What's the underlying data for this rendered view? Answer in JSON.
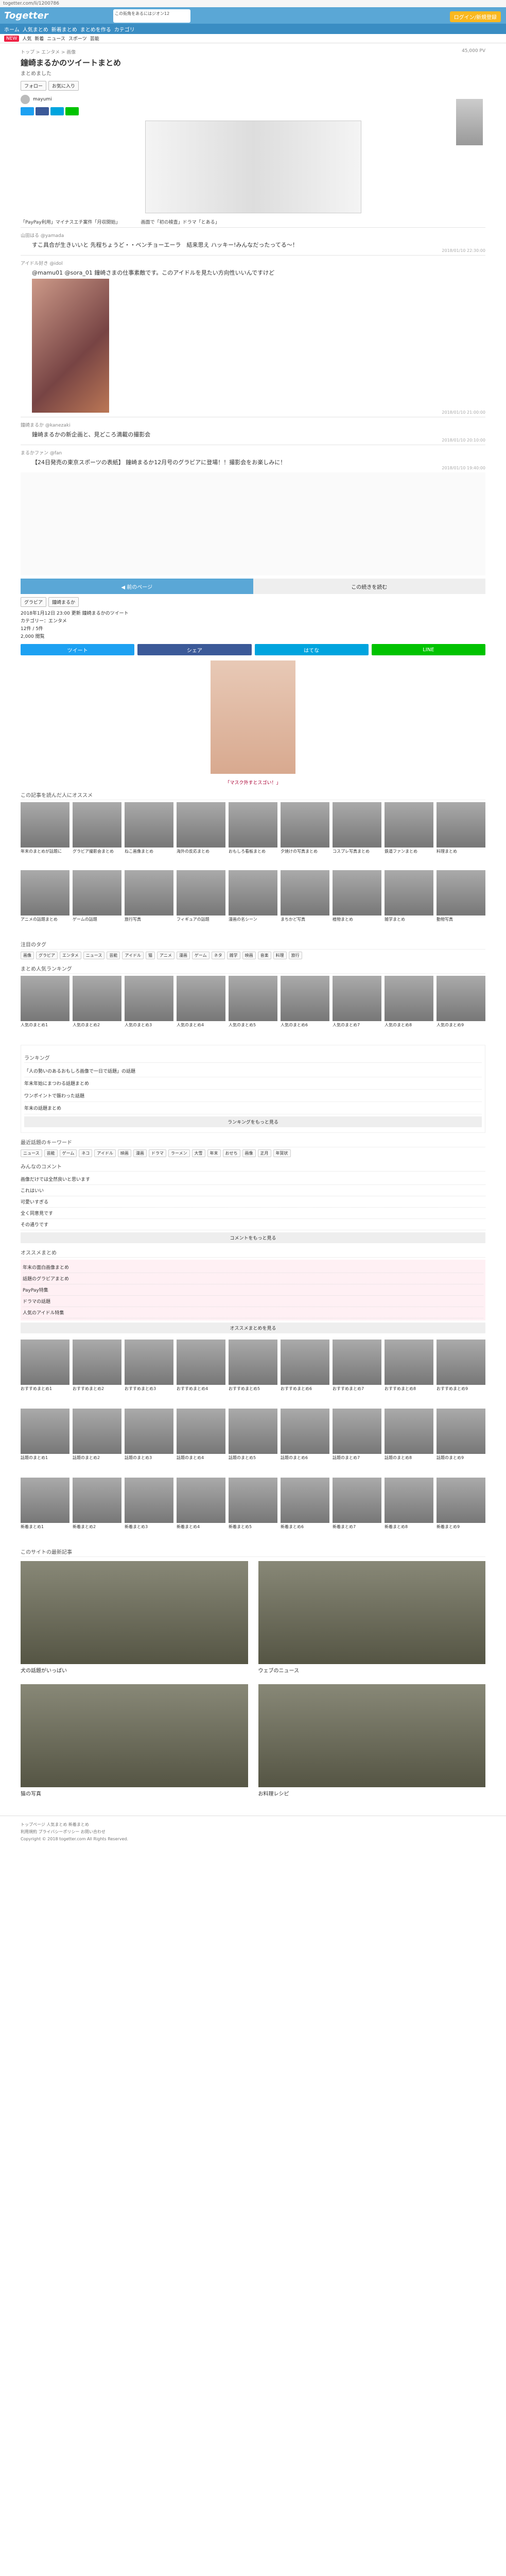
{
  "browser": {
    "url": "togetter.com/li/1200786"
  },
  "header": {
    "logo": "Togetter",
    "banner": "この街角をあるにはジオン12",
    "login": "ログイン/新規登録",
    "nav": [
      "ホーム",
      "人気まとめ",
      "新着まとめ",
      "まとめを作る",
      "カテゴリ"
    ],
    "subnav_new": "NEW",
    "subnav": [
      "人気",
      "新着",
      "ニュース",
      "スポーツ",
      "芸能"
    ]
  },
  "article": {
    "breadcrumb": "トップ > エンタメ > 画像",
    "stats": "45,000 PV",
    "title": "鐘崎まるかのツイートまとめ",
    "subtitle": "まとめました",
    "btn_follow": "フォロー",
    "btn_fav": "お気に入り",
    "user": "mayumi",
    "ads": [
      "「PayPay利用」マイナスエチ案件「月収開始」",
      "画面で「初の検査」ドラマ「とある」"
    ],
    "tweets": [
      {
        "name": "山田はる @yamada",
        "text": "すこ具合が生きいいと\n先程ちょうど・・ベンチョーエーラ　結来思え\nハッキー!みんなだったってる〜！",
        "date": "2018/01/10 22:30:00"
      },
      {
        "name": "アイドル好き @idol",
        "text": "@mamu01 @sora_01 鐘崎さまの仕事素敵です。このアイドルを見たい方向性いいんですけど",
        "date": "2018/01/10 21:00:00",
        "photo": true
      },
      {
        "name": "鐘崎まるか @kanezaki",
        "text": "鐘崎まるかの新企画と、見どころ満載の撮影会",
        "date": "2018/01/10 20:10:00"
      },
      {
        "name": "まるかファン @fan",
        "text": "【24日発売の東京スポーツの表紙】 鐘崎まるか12月号のグラビアに登場！！撮影会をお楽しみに！",
        "date": "2018/01/10 19:40:00"
      }
    ],
    "pager_prev": "◀ 前のページ",
    "pager_next": "この続きを読む",
    "tags": [
      "グラビア",
      "鐘崎まるか"
    ],
    "info": [
      "2018年1月12日 23:00 更新 鐘崎まるかのツイート",
      "カテゴリー：エンタメ",
      "12件 / 5件",
      "2,000 閲覧"
    ],
    "share": [
      "ツイート",
      "シェア",
      "はてな",
      "LINE"
    ],
    "adcaption": "「マスク外すとスゴい！」"
  },
  "sections": {
    "related": "この記事を読んだ人にオススメ",
    "related_cards": [
      "年末のまとめが話題に",
      "グラビア撮影会まとめ",
      "ねこ画像まとめ",
      "海外の反応まとめ",
      "おもしろ看板まとめ",
      "夕焼けの写真まとめ",
      "コスプレ写真まとめ",
      "鉄道ファンまとめ",
      "料理まとめ",
      "アニメの話題まとめ",
      "ゲームの話題",
      "旅行写真",
      "フィギュアの話題",
      "漫画の名シーン",
      "まちかど写真",
      "植物まとめ",
      "雑学まとめ",
      "動物写真"
    ],
    "tags_title": "注目のタグ",
    "tags": [
      "画像",
      "グラビア",
      "エンタメ",
      "ニュース",
      "芸能",
      "アイドル",
      "猫",
      "アニメ",
      "漫画",
      "ゲーム",
      "ネタ",
      "雑学",
      "映画",
      "音楽",
      "料理",
      "旅行"
    ],
    "popular": "まとめ人気ランキング",
    "pop_cards": [
      "人気のまとめ1",
      "人気のまとめ2",
      "人気のまとめ3",
      "人気のまとめ4",
      "人気のまとめ5",
      "人気のまとめ6",
      "人気のまとめ7",
      "人気のまとめ8",
      "人気のまとめ9"
    ],
    "ranking_title": "ランキング",
    "ranking": [
      "「人の勢いのあるおもしろ画像で一日で話題」の話題",
      "年末年始にまつわる話題まとめ",
      "ワンポイントで賑わった話題",
      "年末の話題まとめ"
    ],
    "ranking_more": "ランキングをもっと見る",
    "words_title": "最近話題のキーワード",
    "words": [
      "ニュース",
      "芸能",
      "ゲーム",
      "ネコ",
      "アイドル",
      "映画",
      "漫画",
      "ドラマ",
      "ラーメン",
      "大雪",
      "年末",
      "おせち",
      "画像",
      "正月",
      "年賀状"
    ],
    "comments_title": "みんなのコメント",
    "comments": [
      "画像だけでは全然良いと思います",
      "これはいい",
      "可愛いすぎる",
      "全く同意見です",
      "その通りです"
    ],
    "comments_more": "コメントをもっと見る",
    "recommend_title": "オススメまとめ",
    "recommend": [
      "年末の面白画像まとめ",
      "話題のグラビアまとめ",
      "PayPay特集",
      "ドラマの話題",
      "人気のアイドル特集"
    ],
    "recommend_more": "オススメまとめを見る",
    "grid2": [
      "おすすめまとめ1",
      "おすすめまとめ2",
      "おすすめまとめ3",
      "おすすめまとめ4",
      "おすすめまとめ5",
      "おすすめまとめ6",
      "おすすめまとめ7",
      "おすすめまとめ8",
      "おすすめまとめ9"
    ],
    "grid3": [
      "話題のまとめ1",
      "話題のまとめ2",
      "話題のまとめ3",
      "話題のまとめ4",
      "話題のまとめ5",
      "話題のまとめ6",
      "話題のまとめ7",
      "話題のまとめ8",
      "話題のまとめ9"
    ],
    "grid4": [
      "新着まとめ1",
      "新着まとめ2",
      "新着まとめ3",
      "新着まとめ4",
      "新着まとめ5",
      "新着まとめ6",
      "新着まとめ7",
      "新着まとめ8",
      "新着まとめ9"
    ],
    "feed_title": "このサイトの最新記事",
    "feed": [
      "犬の話題がいっぱい",
      "ウェブのニュース",
      "猫の写真",
      "お料理レシピ"
    ]
  },
  "footer": [
    "トップページ 人気まとめ 新着まとめ",
    "利用規約 プライバシーポリシー お問い合わせ",
    "Copyright © 2018 togetter.com All Rights Reserved."
  ]
}
